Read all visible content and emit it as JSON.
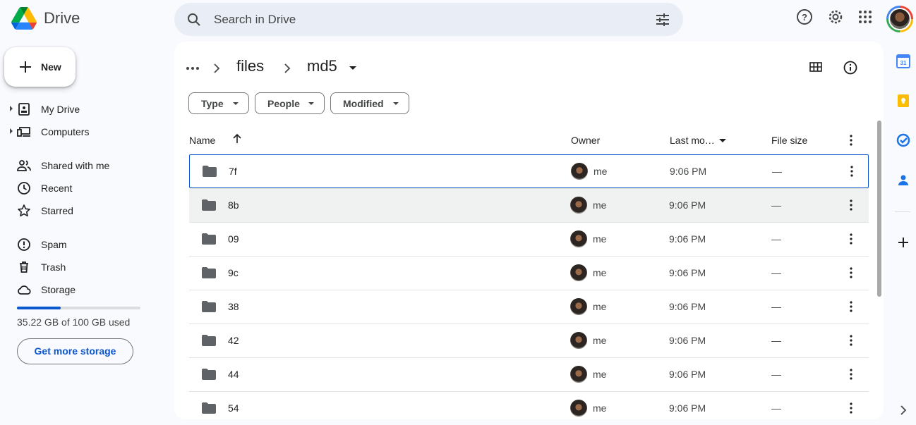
{
  "app": {
    "name": "Drive"
  },
  "search": {
    "placeholder": "Search in Drive"
  },
  "sidebar": {
    "new_label": "New",
    "items": [
      {
        "label": "My Drive",
        "icon": "my-drive-icon",
        "expandable": true
      },
      {
        "label": "Computers",
        "icon": "computers-icon",
        "expandable": true
      },
      {
        "label": "Shared with me",
        "icon": "shared-icon"
      },
      {
        "label": "Recent",
        "icon": "clock-icon"
      },
      {
        "label": "Starred",
        "icon": "star-icon"
      },
      {
        "label": "Spam",
        "icon": "spam-icon"
      },
      {
        "label": "Trash",
        "icon": "trash-icon"
      },
      {
        "label": "Storage",
        "icon": "cloud-icon"
      }
    ],
    "storage": {
      "used_text": "35.22 GB of 100 GB used",
      "used_fraction": 0.3522,
      "button_label": "Get more storage"
    }
  },
  "breadcrumb": {
    "items": [
      "files",
      "md5"
    ]
  },
  "filters": [
    "Type",
    "People",
    "Modified"
  ],
  "table": {
    "columns": {
      "name": "Name",
      "owner": "Owner",
      "modified": "Last mo…",
      "size": "File size"
    },
    "rows": [
      {
        "name": "7f",
        "owner": "me",
        "modified": "9:06 PM",
        "size": "—"
      },
      {
        "name": "8b",
        "owner": "me",
        "modified": "9:06 PM",
        "size": "—"
      },
      {
        "name": "09",
        "owner": "me",
        "modified": "9:06 PM",
        "size": "—"
      },
      {
        "name": "9c",
        "owner": "me",
        "modified": "9:06 PM",
        "size": "—"
      },
      {
        "name": "38",
        "owner": "me",
        "modified": "9:06 PM",
        "size": "—"
      },
      {
        "name": "42",
        "owner": "me",
        "modified": "9:06 PM",
        "size": "—"
      },
      {
        "name": "44",
        "owner": "me",
        "modified": "9:06 PM",
        "size": "—"
      },
      {
        "name": "54",
        "owner": "me",
        "modified": "9:06 PM",
        "size": "—"
      }
    ]
  },
  "colors": {
    "accent": "#0b57d0",
    "background": "#f8fafd",
    "search_bg": "#e9eef6"
  }
}
